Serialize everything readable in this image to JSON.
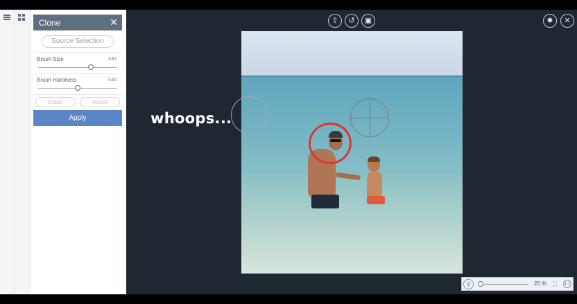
{
  "panel": {
    "title": "Clone",
    "source_selection_label": "Source Selection",
    "brush_size": {
      "label": "Brush Size",
      "value": "0.67"
    },
    "brush_hardness": {
      "label": "Brush Hardness",
      "value": "0.50"
    },
    "erase_label": "Erase",
    "reset_label": "Reset",
    "apply_label": "Apply"
  },
  "toolbar": {
    "upload_icon": "upload-icon",
    "undo_icon": "undo-icon",
    "save_icon": "save-icon",
    "settings_icon": "gear-icon",
    "close_icon": "close-icon"
  },
  "canvas": {
    "annotation_text": "whoops..."
  },
  "zoom": {
    "value": "20 %",
    "level": 0.0,
    "actual_size_label": "1:1"
  },
  "colors": {
    "apply": "#5a86c8",
    "header": "#5e6f80",
    "annotation_circle": "#e3332d"
  }
}
